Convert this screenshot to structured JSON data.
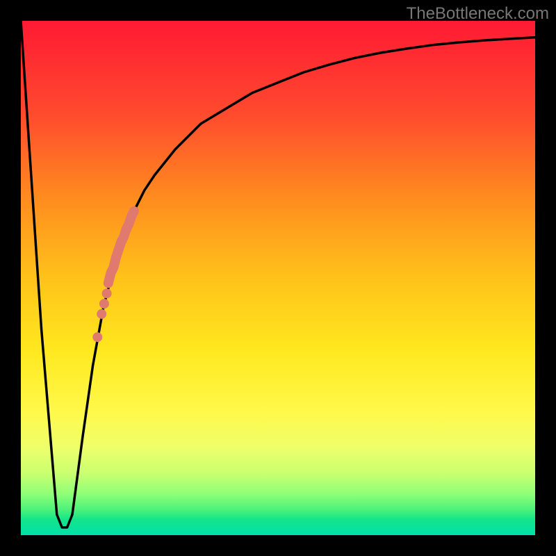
{
  "watermark": "TheBottleneck.com",
  "chart_data": {
    "type": "line",
    "title": "",
    "xlabel": "",
    "ylabel": "",
    "xlim": [
      0,
      100
    ],
    "ylim": [
      0,
      100
    ],
    "series": [
      {
        "name": "bottleneck-curve",
        "x": [
          0,
          4,
          7,
          8,
          9,
          10,
          12,
          14,
          16,
          18,
          20,
          22,
          24,
          26,
          30,
          35,
          40,
          45,
          50,
          55,
          60,
          65,
          70,
          75,
          80,
          85,
          90,
          95,
          100
        ],
        "values": [
          100,
          40,
          4,
          1.5,
          1.5,
          4,
          19,
          33,
          44,
          52,
          58,
          63,
          67,
          70,
          75,
          80,
          83,
          86,
          88,
          90,
          91.5,
          92.8,
          93.8,
          94.6,
          95.3,
          95.8,
          96.2,
          96.5,
          96.8
        ]
      },
      {
        "name": "highlight-segment",
        "x": [
          17.0,
          17.5,
          18.0,
          18.5,
          19.0,
          19.5,
          20.0,
          20.5,
          21.0,
          21.5,
          22.0
        ],
        "values": [
          49.0,
          51.0,
          52.0,
          54.0,
          55.5,
          57.0,
          58.0,
          59.5,
          60.5,
          62.0,
          63.0
        ]
      }
    ],
    "highlight_dots": [
      {
        "x": 15.7,
        "y": 43.0
      },
      {
        "x": 16.2,
        "y": 45.0
      },
      {
        "x": 16.7,
        "y": 47.0
      },
      {
        "x": 14.9,
        "y": 38.5
      }
    ],
    "colors": {
      "curve": "#000000",
      "highlight": "#e07a6f"
    }
  }
}
